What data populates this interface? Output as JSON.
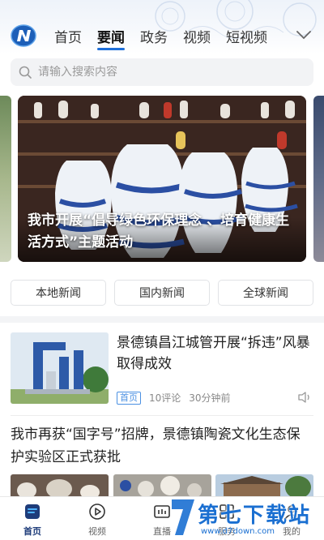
{
  "header": {
    "logo_icon": "app-logo-n",
    "tabs": [
      {
        "label": "首页"
      },
      {
        "label": "要闻"
      },
      {
        "label": "政务"
      },
      {
        "label": "视频"
      },
      {
        "label": "短视频"
      }
    ],
    "active_tab": "要闻",
    "more_icon": "chevron-down-icon",
    "accent_color": "#1e6fd9"
  },
  "search": {
    "placeholder": "请输入搜索内容",
    "value": ""
  },
  "carousel": {
    "caption": "我市开展“倡导绿色环保理念 、培育健康生活方式”主题活动"
  },
  "categories": [
    {
      "label": "本地新闻"
    },
    {
      "label": "国内新闻"
    },
    {
      "label": "全球新闻"
    }
  ],
  "news": [
    {
      "title": "景德镇昌江城管开展“拆违”风暴取得成效",
      "badge": "首页",
      "comments": "10评论",
      "time": "30分钟前",
      "badge_color": "#4a90e2"
    },
    {
      "title": "我市再获“国字号”招牌，景德镇陶瓷文化生态保护实验区正式获批"
    }
  ],
  "bottom_nav": [
    {
      "label": "首页",
      "icon": "home-icon"
    },
    {
      "label": "视频",
      "icon": "play-icon"
    },
    {
      "label": "直播",
      "icon": "live-icon"
    },
    {
      "label": "服务",
      "icon": "service-icon"
    },
    {
      "label": "我的",
      "icon": "profile-icon"
    }
  ],
  "watermark": {
    "text": "第七下载站",
    "url": "www.d7down.com"
  }
}
